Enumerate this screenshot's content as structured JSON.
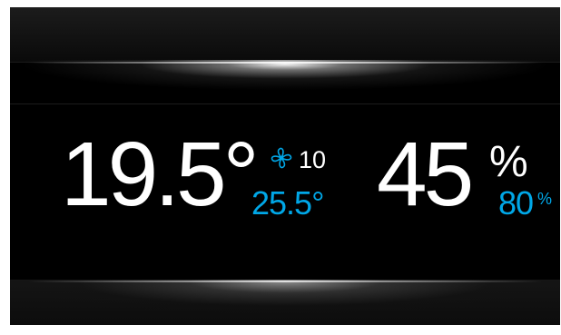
{
  "thermostat": {
    "current_temperature": "19.5°",
    "fan_speed": "10",
    "setpoint_temperature": "25.5°",
    "fan_icon": "fan-icon"
  },
  "humidity": {
    "current_value": "45",
    "unit": "%",
    "setpoint_value": "80",
    "setpoint_unit": "%"
  },
  "colors": {
    "background": "#000000",
    "primary_text": "#ffffff",
    "accent": "#00a7e7"
  }
}
